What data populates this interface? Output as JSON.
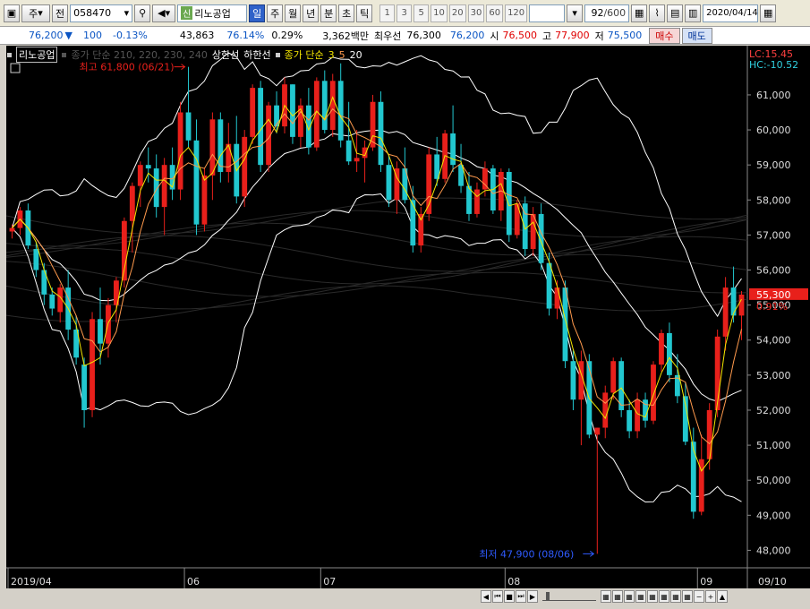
{
  "toolbar": {
    "market": "주",
    "prev_label": "전",
    "code": "058470",
    "badge": "신",
    "stock_name": "리노공업",
    "periods": [
      "일",
      "주",
      "월",
      "년",
      "분",
      "초",
      "틱"
    ],
    "active_period": "일",
    "intervals": [
      "1",
      "3",
      "5",
      "10",
      "20",
      "30",
      "60",
      "120"
    ],
    "count": "92",
    "total": "/600",
    "date": "2020/04/14"
  },
  "quote": {
    "price": "76,200",
    "change": "100",
    "change_pct": "-0.13%",
    "volume": "43,863",
    "vol_ratio": "76.14%",
    "turnover": "0.29%",
    "amount": "3,362백만",
    "best_ask_label": "최우선",
    "best_ask": "76,300",
    "best_bid": "76,200",
    "open_label": "시",
    "open": "76,500",
    "high_label": "고",
    "high": "77,900",
    "low_label": "저",
    "low": "75,500",
    "buy_label": "매수",
    "sell_label": "매도"
  },
  "legend": {
    "name": "리노공업",
    "ma_dim": "종가 단순 210, 220, 230, 240",
    "upper": "상한선",
    "lower": "하한선",
    "ma_label": "종가 단순",
    "ma_periods": [
      "3",
      "5",
      "20"
    ]
  },
  "right_labels": {
    "lc": "LC:15.45",
    "hc": "HC:-10.52",
    "last": "55,300",
    "last_pct": "0.91%"
  },
  "annotations": {
    "high": "최고 61,800 (06/21)",
    "low": "최저 47,900 (08/06)"
  },
  "colors": {
    "up": "#e8201b",
    "down": "#22c7cf",
    "ma3": "#f3e500",
    "ma5": "#ff9a4d",
    "bollinger": "#ffffff"
  },
  "chart_data": {
    "type": "candlestick",
    "title": "리노공업",
    "y_ticks": [
      "61,000",
      "60,000",
      "59,000",
      "58,000",
      "57,000",
      "56,000",
      "55,000",
      "54,000",
      "53,000",
      "52,000",
      "51,000",
      "50,000",
      "49,000",
      "48,000"
    ],
    "ylim": [
      47500,
      62200
    ],
    "x_labels": [
      "2019/04",
      "06",
      "07",
      "08",
      "09",
      "09/10"
    ],
    "high_point": {
      "value": 61800,
      "date": "06/21"
    },
    "low_point": {
      "value": 47900,
      "date": "08/06"
    },
    "last_close": 55300,
    "candles": [
      [
        57100,
        57300,
        56900,
        57200
      ],
      [
        57200,
        57800,
        57000,
        57700
      ],
      [
        57700,
        57900,
        56600,
        56700
      ],
      [
        56600,
        56800,
        55800,
        56000
      ],
      [
        56000,
        56200,
        55000,
        55300
      ],
      [
        55300,
        55500,
        54700,
        54900
      ],
      [
        54800,
        55600,
        54500,
        55500
      ],
      [
        55500,
        56000,
        54000,
        54300
      ],
      [
        54300,
        54700,
        53300,
        53500
      ],
      [
        53300,
        53500,
        51500,
        52000
      ],
      [
        52000,
        54800,
        51800,
        54600
      ],
      [
        54600,
        55500,
        53300,
        53900
      ],
      [
        53900,
        55200,
        53500,
        55000
      ],
      [
        55000,
        55800,
        54500,
        55700
      ],
      [
        55700,
        57500,
        55500,
        57400
      ],
      [
        57400,
        58500,
        56500,
        58400
      ],
      [
        58400,
        59100,
        57800,
        59000
      ],
      [
        59000,
        59500,
        58500,
        58900
      ],
      [
        58900,
        59300,
        57500,
        57800
      ],
      [
        57800,
        59200,
        57000,
        59000
      ],
      [
        59000,
        59500,
        58000,
        58300
      ],
      [
        58300,
        60800,
        58000,
        60500
      ],
      [
        60500,
        61800,
        59500,
        59700
      ],
      [
        59700,
        60300,
        57000,
        57300
      ],
      [
        57300,
        58900,
        57100,
        58700
      ],
      [
        58700,
        60500,
        58000,
        60300
      ],
      [
        60300,
        60500,
        58500,
        58800
      ],
      [
        58800,
        60200,
        58500,
        59600
      ],
      [
        59600,
        60400,
        57900,
        58100
      ],
      [
        58100,
        60000,
        57800,
        59800
      ],
      [
        59800,
        61300,
        59600,
        61200
      ],
      [
        61200,
        61400,
        58800,
        59000
      ],
      [
        59000,
        60800,
        58800,
        60700
      ],
      [
        60700,
        61100,
        59900,
        60100
      ],
      [
        60100,
        61500,
        59900,
        61300
      ],
      [
        61300,
        61300,
        59600,
        59800
      ],
      [
        59800,
        60900,
        59500,
        60700
      ],
      [
        60700,
        61200,
        59300,
        59500
      ],
      [
        59500,
        61500,
        59400,
        61400
      ],
      [
        61400,
        61700,
        59900,
        60000
      ],
      [
        60000,
        61600,
        59800,
        61400
      ],
      [
        61400,
        61900,
        59500,
        59700
      ],
      [
        59700,
        60800,
        59000,
        59100
      ],
      [
        59100,
        60000,
        58800,
        59200
      ],
      [
        59200,
        59700,
        58500,
        59500
      ],
      [
        59500,
        61000,
        59400,
        60800
      ],
      [
        60800,
        61100,
        58800,
        59000
      ],
      [
        59000,
        59300,
        57800,
        58000
      ],
      [
        58000,
        59100,
        57600,
        58900
      ],
      [
        58900,
        59500,
        57900,
        58000
      ],
      [
        58000,
        58400,
        56500,
        56700
      ],
      [
        56700,
        57800,
        56500,
        57600
      ],
      [
        57600,
        59500,
        57400,
        59300
      ],
      [
        59300,
        59800,
        58400,
        58600
      ],
      [
        58600,
        60000,
        58500,
        59900
      ],
      [
        59900,
        60700,
        58800,
        59000
      ],
      [
        59000,
        59600,
        58200,
        58400
      ],
      [
        58400,
        58800,
        57400,
        57600
      ],
      [
        57600,
        58500,
        57500,
        58300
      ],
      [
        58300,
        59100,
        58100,
        58900
      ],
      [
        58900,
        59000,
        57600,
        57700
      ],
      [
        57700,
        58900,
        57400,
        58800
      ],
      [
        58800,
        58900,
        56800,
        57000
      ],
      [
        57000,
        58000,
        56900,
        57900
      ],
      [
        57900,
        58100,
        56400,
        56600
      ],
      [
        56600,
        57800,
        56400,
        57600
      ],
      [
        57600,
        57900,
        56000,
        56200
      ],
      [
        56200,
        56500,
        54700,
        54900
      ],
      [
        54900,
        55700,
        54600,
        55500
      ],
      [
        55500,
        55700,
        53200,
        53400
      ],
      [
        53400,
        53700,
        52000,
        52300
      ],
      [
        52300,
        53700,
        51000,
        53400
      ],
      [
        53400,
        53600,
        51200,
        51300
      ],
      [
        51300,
        51500,
        47900,
        51500
      ],
      [
        51500,
        52700,
        51200,
        52500
      ],
      [
        52500,
        53500,
        52300,
        53400
      ],
      [
        53400,
        53500,
        51800,
        52000
      ],
      [
        52000,
        52300,
        51200,
        51400
      ],
      [
        51400,
        52500,
        51200,
        52300
      ],
      [
        52300,
        52500,
        51500,
        51700
      ],
      [
        51700,
        53400,
        51600,
        53300
      ],
      [
        53300,
        54300,
        53100,
        54200
      ],
      [
        54200,
        54500,
        52800,
        53000
      ],
      [
        53000,
        53600,
        52200,
        52400
      ],
      [
        52400,
        52800,
        51000,
        51100
      ],
      [
        51100,
        51500,
        48900,
        49100
      ],
      [
        49100,
        51300,
        49000,
        50600
      ],
      [
        50600,
        52200,
        50300,
        52000
      ],
      [
        52000,
        54300,
        51800,
        54100
      ],
      [
        54100,
        55800,
        53700,
        55500
      ],
      [
        55500,
        56100,
        54500,
        54700
      ],
      [
        54700,
        55400,
        54000,
        55300
      ]
    ]
  }
}
